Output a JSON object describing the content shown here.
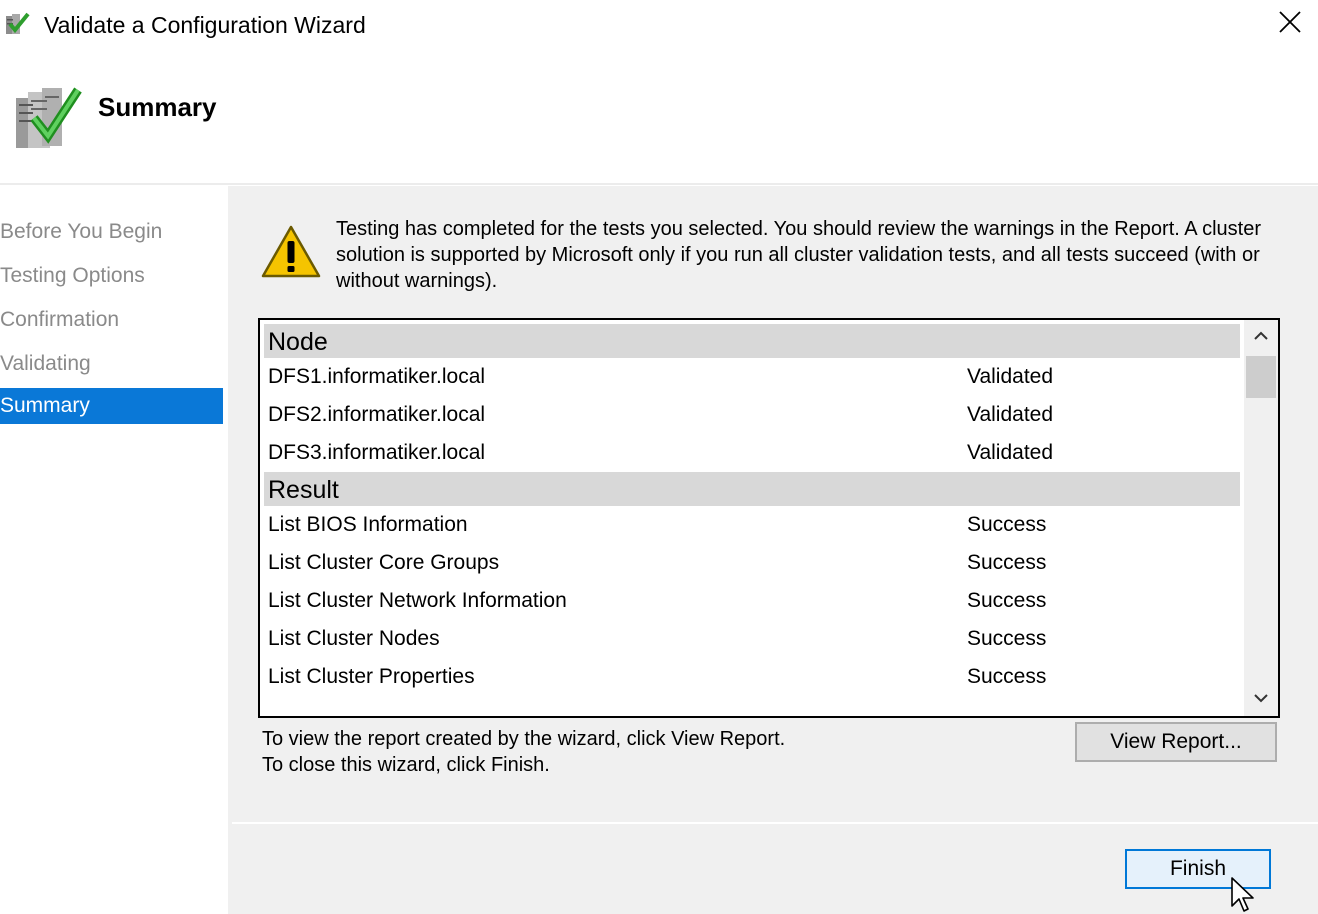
{
  "window": {
    "title": "Validate a Configuration Wizard"
  },
  "header": {
    "title": "Summary"
  },
  "sidebar": {
    "items": [
      {
        "label": "Before You Begin",
        "active": false
      },
      {
        "label": "Testing Options",
        "active": false
      },
      {
        "label": "Confirmation",
        "active": false
      },
      {
        "label": "Validating",
        "active": false
      },
      {
        "label": "Summary",
        "active": true
      }
    ]
  },
  "main": {
    "message": "Testing has completed for the tests you selected. You should review the warnings in the Report.  A cluster solution is supported by Microsoft only if you run all cluster validation tests, and all tests succeed (with or without warnings).",
    "results": {
      "groups": [
        {
          "name": "Node",
          "rows": [
            {
              "name": "DFS1.informatiker.local",
              "status": "Validated"
            },
            {
              "name": "DFS2.informatiker.local",
              "status": "Validated"
            },
            {
              "name": "DFS3.informatiker.local",
              "status": "Validated"
            }
          ]
        },
        {
          "name": "Result",
          "rows": [
            {
              "name": "List BIOS Information",
              "status": "Success"
            },
            {
              "name": "List Cluster Core Groups",
              "status": "Success"
            },
            {
              "name": "List Cluster Network Information",
              "status": "Success"
            },
            {
              "name": "List Cluster Nodes",
              "status": "Success"
            },
            {
              "name": "List Cluster Properties",
              "status": "Success"
            }
          ]
        }
      ]
    },
    "instructions_line1": "To view the report created by the wizard, click View Report.",
    "instructions_line2": "To close this wizard, click Finish.",
    "view_report_label": "View Report...",
    "finish_label": "Finish"
  },
  "icons": {
    "app": "wizard-checkmark-icon",
    "header": "server-check-icon",
    "warning": "warning-icon",
    "close": "close-icon"
  },
  "colors": {
    "accent": "#0a78d7",
    "content_bg": "#f0f0f0",
    "group_header_bg": "#d8d8d8"
  }
}
